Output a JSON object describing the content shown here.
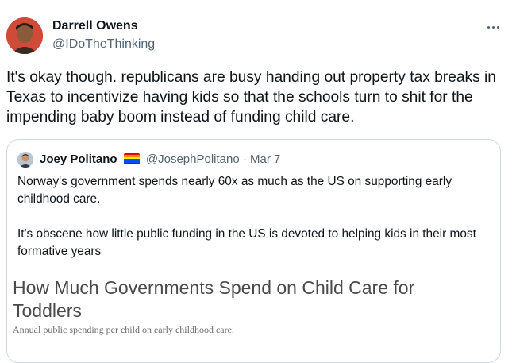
{
  "tweet": {
    "author_name": "Darrell Owens",
    "author_handle": "@IDoTheThinking",
    "text": "It's okay though. republicans are busy handing out property tax breaks in Texas to incentivize having kids so that the schools turn to shit for the impending baby boom instead of funding child care."
  },
  "quoted_tweet": {
    "author_name": "Joey Politano",
    "flag_icon": "rainbow-flag-icon",
    "author_handle": "@JosephPolitano",
    "separator": "·",
    "date": "Mar 7",
    "text": "Norway's government spends nearly 60x as much as the US on supporting early childhood care.\n\nIt's obscene how little public funding in the US is devoted to helping kids in their most formative years",
    "chart_title": "How Much Governments Spend on Child Care for Toddlers",
    "chart_subtitle": "Annual public spending per child on early childhood care."
  },
  "icons": {
    "more": "more-horizontal-icon",
    "avatar": "avatar",
    "quoted_avatar": "avatar"
  },
  "colors": {
    "text_primary": "#0f1419",
    "text_secondary": "#536471",
    "border": "#cfd9de"
  }
}
